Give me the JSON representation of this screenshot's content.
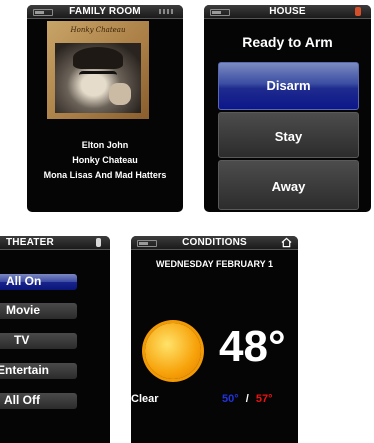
{
  "family_room": {
    "title": "FAMILY ROOM",
    "album_text": "Honky Chateau",
    "artist": "Elton John",
    "album": "Honky Chateau",
    "track": "Mona Lisas And Mad Hatters"
  },
  "house": {
    "title": "HOUSE",
    "status": "Ready to Arm",
    "buttons": [
      "Disarm",
      "Stay",
      "Away"
    ],
    "active_button": "Disarm"
  },
  "theater": {
    "title": "THEATER",
    "buttons": [
      "All On",
      "Movie",
      "TV",
      "Entertain",
      "All Off"
    ],
    "active_button": "All On"
  },
  "conditions": {
    "title": "CONDITIONS",
    "date": "WEDNESDAY FEBRUARY 1",
    "temperature": "48°",
    "condition": "Clear",
    "low": "50°",
    "separator": "/",
    "high": "57°",
    "low_color": "#2233dd",
    "high_color": "#ee1111"
  },
  "icons": [
    "battery-icon",
    "signal-icon",
    "alert-icon",
    "home-icon",
    "sun-icon"
  ],
  "colors": {
    "active_button": "#1f2c8e",
    "panel_bg": "#050505"
  }
}
